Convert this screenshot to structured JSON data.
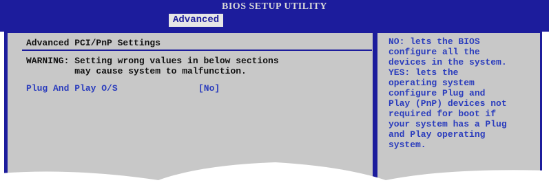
{
  "window": {
    "title": "BIOS SETUP UTILITY",
    "active_tab": "Advanced"
  },
  "main": {
    "section_title": "Advanced PCI/PnP Settings",
    "warning_lines": [
      "WARNING: Setting wrong values in below sections",
      "         may cause system to malfunction."
    ],
    "options": [
      {
        "label": "Plug And Play O/S",
        "value": "[No]"
      }
    ]
  },
  "help": {
    "lines": [
      "NO: lets the BIOS",
      "configure all the",
      "devices in the system.",
      "YES: lets the",
      "operating system",
      "configure Plug and",
      "Play (PnP) devices not",
      "required for boot if",
      "your system has a Plug",
      "and Play operating",
      "system."
    ]
  },
  "colors": {
    "bios_blue": "#1c1c9c",
    "panel_gray": "#c8c8c8",
    "option_text": "#2a3cbd",
    "main_text": "#111111"
  }
}
